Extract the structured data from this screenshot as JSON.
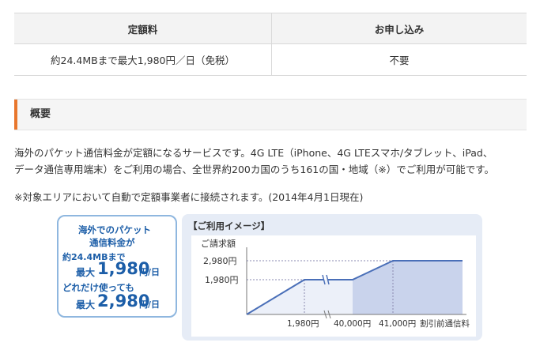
{
  "table": {
    "headers": [
      "定額料",
      "お申し込み"
    ],
    "row": [
      "約24.4MBまで最大1,980円／日（免税）",
      "不要"
    ]
  },
  "section": {
    "title": "概要"
  },
  "paragraphs": {
    "line1": "海外のパケット通信料金が定額になるサービスです。4G LTE（iPhone、4G LTEスマホ/タブレット、iPad、",
    "line2": "データ通信専用端末）をご利用の場合、全世界約200カ国のうち161の国・地域（※）でご利用が可能です。",
    "note": "※対象エリアにおいて自動で定額事業者に接続されます。(2014年4月1日現在)"
  },
  "callout": {
    "line1": "海外でのパケット",
    "line2": "通信料金が",
    "line3": "約24.4MBまで",
    "max_label": "最大",
    "price1": "1,980",
    "unit": "円/日",
    "line5": "どれだけ使っても",
    "price2": "2,980"
  },
  "chart": {
    "title": "【ご利用イメージ】",
    "ylabel": "ご請求額",
    "ytick_high": "2,980円",
    "ytick_low": "1,980円",
    "xticks": [
      "1,980円",
      "40,000円",
      "41,000円"
    ],
    "xlabel": "割引前通信料"
  },
  "chart_data": {
    "type": "line",
    "title": "【ご利用イメージ】",
    "ylabel": "ご請求額",
    "xlabel": "割引前通信料",
    "x_ticks": [
      "1,980円",
      "40,000円",
      "41,000円"
    ],
    "y_ticks": [
      "1,980円",
      "2,980円"
    ],
    "series": [
      {
        "values": [
          0,
          1980,
          1980,
          2980,
          2980
        ]
      }
    ]
  },
  "colors": {
    "accent": "#e8762d",
    "blue": "#1c5ea8",
    "panel": "#e6ecf6"
  }
}
